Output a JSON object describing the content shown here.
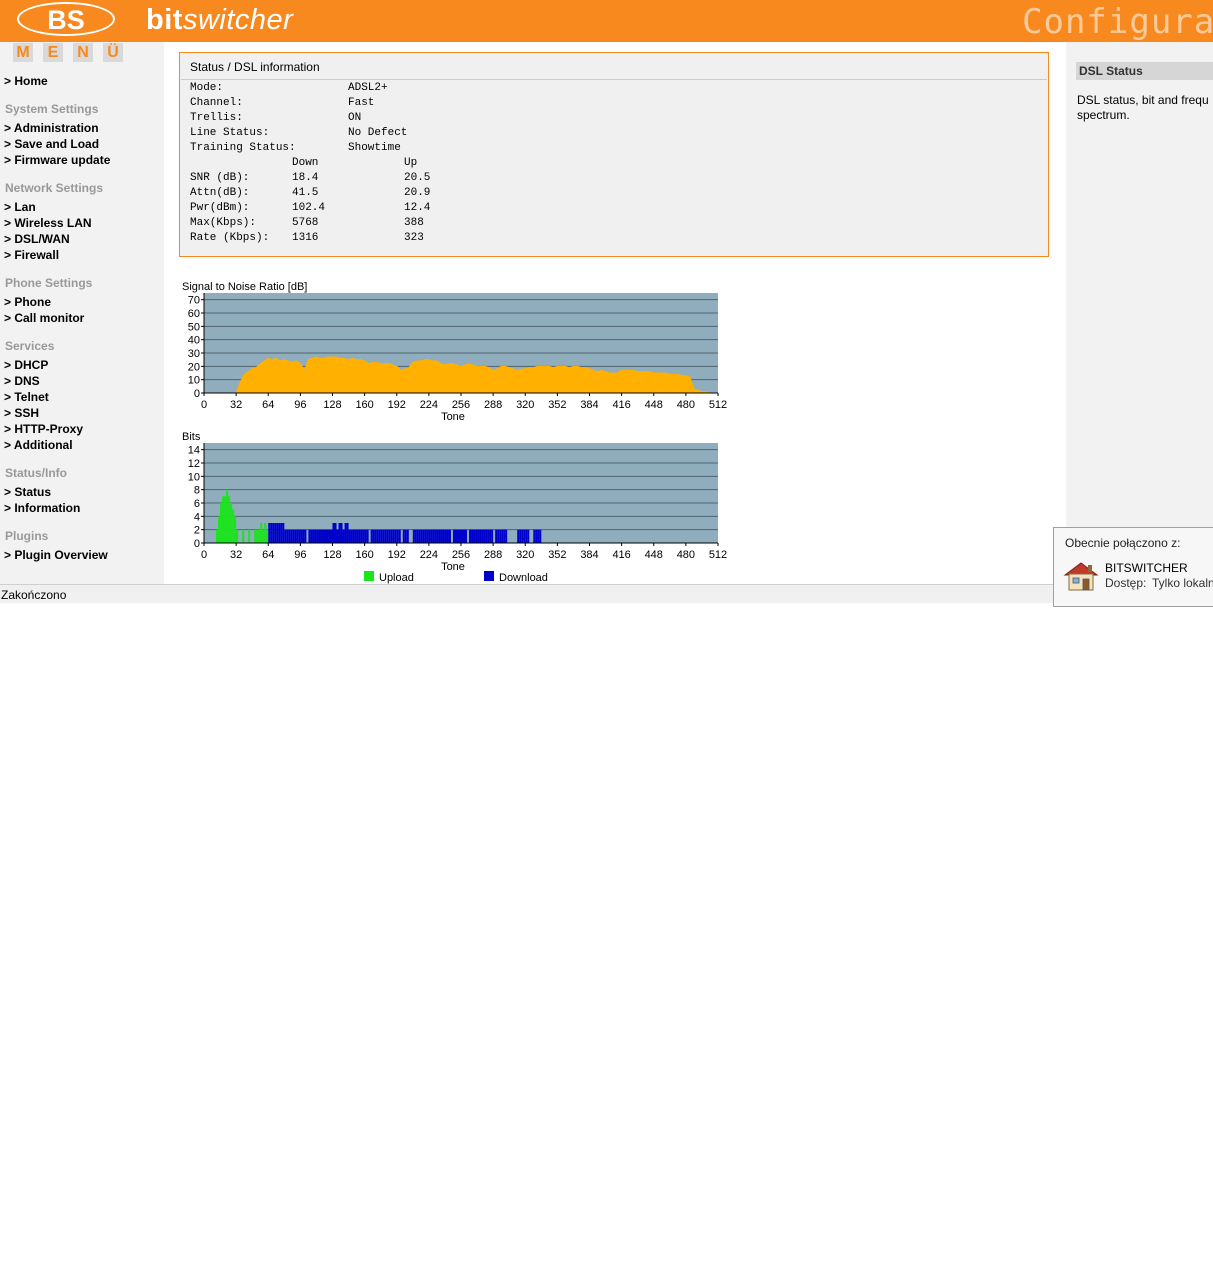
{
  "header": {
    "logo": "BS",
    "brand_bold": "bit",
    "brand_italic": "switcher",
    "title": "Configurati"
  },
  "sidebar": {
    "menu_letters": [
      "M",
      "E",
      "N",
      "Ü"
    ],
    "home": "> Home",
    "groups": [
      {
        "title": "System Settings",
        "items": [
          "> Administration",
          "> Save and Load",
          "> Firmware update"
        ]
      },
      {
        "title": "Network Settings",
        "items": [
          "> Lan",
          "> Wireless LAN",
          "> DSL/WAN",
          "> Firewall"
        ]
      },
      {
        "title": "Phone Settings",
        "items": [
          "> Phone",
          "> Call monitor"
        ]
      },
      {
        "title": "Services",
        "items": [
          "> DHCP",
          "> DNS",
          "> Telnet",
          "> SSH",
          "> HTTP-Proxy",
          "> Additional"
        ]
      },
      {
        "title": "Status/Info",
        "items": [
          "> Status",
          "> Information"
        ]
      },
      {
        "title": "Plugins",
        "items": [
          "> Plugin Overview"
        ]
      }
    ]
  },
  "status": {
    "title": "Status / DSL information",
    "rows": [
      {
        "label": "Mode:",
        "value": "ADSL2+"
      },
      {
        "label": "Channel:",
        "value": "Fast"
      },
      {
        "label": "Trellis:",
        "value": "ON"
      },
      {
        "label": "Line Status:",
        "value": "No Defect"
      },
      {
        "label": "Training Status:",
        "value": "Showtime"
      }
    ],
    "col_down": "Down",
    "col_up": "Up",
    "metrics": [
      {
        "label": "SNR (dB):",
        "down": "18.4",
        "up": "20.5"
      },
      {
        "label": "Attn(dB):",
        "down": "41.5",
        "up": "20.9"
      },
      {
        "label": "Pwr(dBm):",
        "down": "102.4",
        "up": "12.4"
      },
      {
        "label": "Max(Kbps):",
        "down": "5768",
        "up": "388"
      },
      {
        "label": "Rate (Kbps):",
        "down": "1316",
        "up": "323"
      }
    ]
  },
  "chart_data": [
    {
      "type": "area",
      "title": "Signal to Noise Ratio [dB]",
      "xlabel": "Tone",
      "ylabel": "",
      "xlim": [
        0,
        512
      ],
      "ylim": [
        0,
        75
      ],
      "xticks": [
        0,
        32,
        64,
        96,
        128,
        160,
        192,
        224,
        256,
        288,
        320,
        352,
        384,
        416,
        448,
        480,
        512
      ],
      "yticks": [
        0,
        10,
        20,
        30,
        40,
        50,
        60,
        70
      ],
      "grid": true,
      "color": "#ffb000",
      "background": "#8fadbc",
      "series": [
        {
          "x": [
            32,
            36,
            40,
            44,
            48,
            52,
            56,
            60,
            64,
            68,
            72,
            76,
            80,
            84,
            88,
            92,
            96,
            100,
            104,
            108,
            112,
            116,
            120,
            124,
            128,
            132,
            136,
            140,
            144,
            148,
            152,
            156,
            160,
            164,
            168,
            172,
            176,
            180,
            184,
            188,
            192,
            196,
            200,
            204,
            208,
            212,
            216,
            220,
            224,
            228,
            232,
            236,
            240,
            244,
            248,
            252,
            256,
            260,
            264,
            268,
            272,
            276,
            280,
            284,
            288,
            292,
            296,
            300,
            304,
            308,
            312,
            316,
            320,
            324,
            328,
            332,
            336,
            340,
            344,
            348,
            352,
            356,
            360,
            364,
            368,
            372,
            376,
            380,
            384,
            388,
            392,
            396,
            400,
            404,
            408,
            412,
            416,
            420,
            424,
            428,
            432,
            436,
            440,
            444,
            448,
            452,
            456,
            460,
            464,
            468,
            472,
            476,
            480,
            484,
            488,
            492,
            496,
            500,
            504,
            508
          ],
          "values": [
            0,
            8,
            14,
            16,
            18,
            19,
            22,
            24,
            26,
            25,
            26,
            24,
            25,
            24,
            23,
            24,
            22,
            17,
            25,
            26,
            27,
            26,
            26,
            27,
            27,
            27,
            26,
            26,
            25,
            26,
            25,
            25,
            24,
            22,
            23,
            23,
            22,
            22,
            22,
            21,
            20,
            17,
            18,
            19,
            23,
            24,
            24,
            25,
            25,
            24,
            24,
            22,
            21,
            22,
            22,
            21,
            20,
            21,
            22,
            21,
            20,
            20,
            20,
            19,
            17,
            18,
            20,
            20,
            19,
            18,
            17,
            18,
            18,
            19,
            19,
            20,
            20,
            20,
            20,
            19,
            20,
            20,
            20,
            19,
            20,
            20,
            19,
            19,
            18,
            17,
            16,
            17,
            16,
            15,
            15,
            15,
            17,
            17,
            17,
            17,
            16,
            16,
            16,
            16,
            15,
            15,
            15,
            15,
            14,
            14,
            14,
            13,
            13,
            12,
            3,
            2,
            1,
            1,
            0,
            0
          ]
        }
      ]
    },
    {
      "type": "bar",
      "title": "Bits",
      "xlabel": "Tone",
      "ylabel": "",
      "xlim": [
        0,
        512
      ],
      "ylim": [
        0,
        15
      ],
      "xticks": [
        0,
        32,
        64,
        96,
        128,
        160,
        192,
        224,
        256,
        288,
        320,
        352,
        384,
        416,
        448,
        480,
        512
      ],
      "yticks": [
        0,
        2,
        4,
        6,
        8,
        10,
        12,
        14
      ],
      "grid": true,
      "background": "#8fadbc",
      "legend": "bottom",
      "series": [
        {
          "name": "Upload",
          "color": "#19e619",
          "x": [
            12,
            14,
            16,
            18,
            20,
            22,
            24,
            26,
            28,
            30,
            32,
            38,
            44,
            50,
            52,
            54,
            56,
            58,
            60,
            62
          ],
          "values": [
            2,
            4,
            6,
            7,
            7,
            8,
            7,
            6,
            5,
            4,
            2,
            2,
            2,
            2,
            2,
            2,
            3,
            2,
            3,
            2
          ]
        },
        {
          "name": "Download",
          "color": "#0000cc",
          "x": [
            64,
            66,
            68,
            70,
            72,
            74,
            76,
            78,
            80,
            82,
            84,
            86,
            88,
            90,
            92,
            94,
            96,
            98,
            100,
            104,
            106,
            108,
            110,
            112,
            114,
            116,
            118,
            120,
            122,
            124,
            126,
            128,
            130,
            132,
            134,
            136,
            138,
            140,
            142,
            144,
            146,
            148,
            150,
            152,
            154,
            156,
            158,
            160,
            162,
            166,
            168,
            170,
            172,
            174,
            176,
            178,
            180,
            182,
            184,
            186,
            188,
            190,
            192,
            194,
            198,
            200,
            202,
            208,
            210,
            212,
            214,
            216,
            218,
            220,
            222,
            224,
            226,
            228,
            230,
            232,
            234,
            236,
            238,
            240,
            242,
            244,
            248,
            250,
            252,
            254,
            256,
            258,
            260,
            264,
            266,
            268,
            270,
            272,
            274,
            276,
            278,
            280,
            282,
            284,
            286,
            290,
            292,
            294,
            296,
            298,
            300,
            312,
            314,
            316,
            318,
            320,
            322,
            328,
            330,
            332,
            334
          ],
          "values": [
            3,
            3,
            3,
            3,
            3,
            3,
            3,
            3,
            2,
            2,
            2,
            2,
            2,
            2,
            2,
            2,
            2,
            2,
            2,
            2,
            2,
            2,
            2,
            2,
            2,
            2,
            2,
            2,
            2,
            2,
            2,
            3,
            3,
            2,
            3,
            3,
            2,
            3,
            3,
            2,
            2,
            2,
            2,
            2,
            2,
            2,
            2,
            2,
            2,
            2,
            2,
            2,
            2,
            2,
            2,
            2,
            2,
            2,
            2,
            2,
            2,
            2,
            2,
            2,
            2,
            2,
            2,
            2,
            2,
            2,
            2,
            2,
            2,
            2,
            2,
            2,
            2,
            2,
            2,
            2,
            2,
            2,
            2,
            2,
            2,
            2,
            2,
            2,
            2,
            2,
            2,
            2,
            2,
            2,
            2,
            2,
            2,
            2,
            2,
            2,
            2,
            2,
            2,
            2,
            2,
            2,
            2,
            2,
            2,
            2,
            2,
            2,
            2,
            2,
            2,
            2,
            2,
            2,
            2,
            2,
            2
          ]
        }
      ]
    }
  ],
  "right_panel": {
    "title": "DSL Status",
    "description": "DSL status, bit and frequ spectrum."
  },
  "statusbar": {
    "text": "Zakończono"
  },
  "popup": {
    "title": "Obecnie połączono z:",
    "name": "BITSWITCHER",
    "access_label": "Dostęp:",
    "access_value": "Tylko lokaln"
  }
}
